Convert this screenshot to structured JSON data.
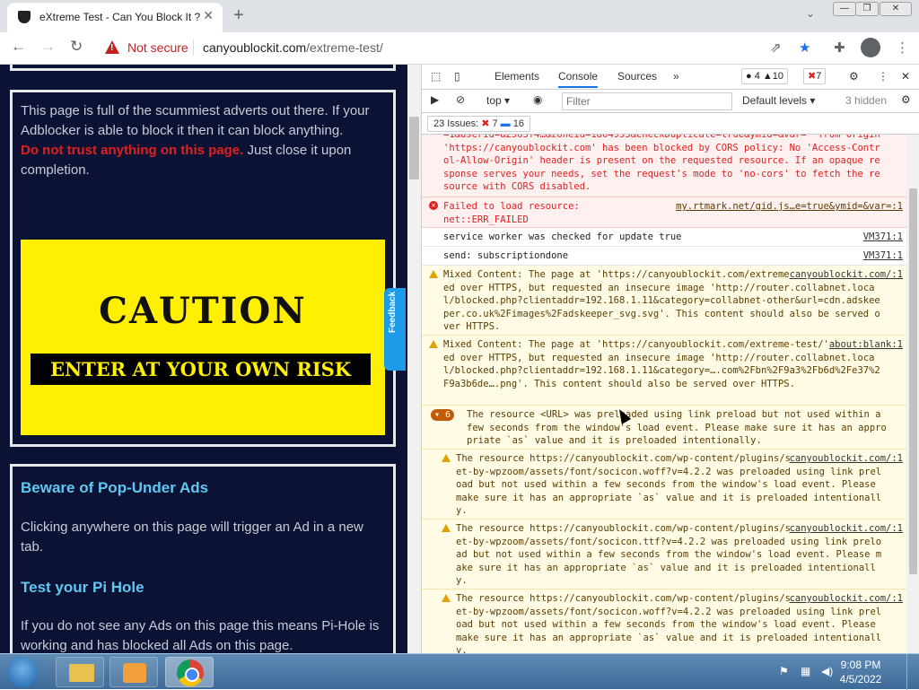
{
  "tab": {
    "title": "eXtreme Test - Can You Block It ?",
    "close": "✕"
  },
  "toolbar": {
    "not_secure": "Not secure",
    "url_host": "canyoublockit.com",
    "url_path": "/extreme-test/"
  },
  "page": {
    "intro": "This page is full of the scummiest adverts out there. If your Adblocker is able to block it then it can block anything.",
    "warning_red": "Do not trust anything on this page.",
    "warning_rest": " Just close it upon completion.",
    "caution_title": "CAUTION",
    "caution_sub": "ENTER AT YOUR OWN RISK",
    "feedback": "Feedback",
    "h1": "Beware of Pop-Under Ads",
    "p1": "Clicking anywhere on this page will trigger an Ad in a new tab.",
    "h2": "Test your Pi Hole",
    "p2": "If you do not see any Ads on this page this means Pi-Hole is working and has blocked all Ads on this page."
  },
  "devtools": {
    "tabs": [
      "Elements",
      "Console",
      "Sources"
    ],
    "counts": {
      "errors": "4",
      "warnings": "10",
      "issues_red": "7"
    },
    "context": "top",
    "filter_placeholder": "Filter",
    "levels": "Default levels",
    "hidden": "3 hidden",
    "issues_label": "23 Issues:",
    "issues_red": "7",
    "issues_blue": "16",
    "messages": [
      {
        "text": "=1&userid=a2563f4…&zoneid=1864953&checkDuplicate=true&ymid=&var=' from origin 'https://canyoublockit.com' has been blocked by CORS policy: No 'Access-Control-Allow-Origin' header is present on the requested resource. If an opaque response serves your needs, set the request's mode to 'no-cors' to fetch the resource with CORS disabled.",
        "src": ""
      },
      {
        "text": "Failed to load resource:\nnet::ERR_FAILED",
        "src": "my.rtmark.net/gid.js…e=true&ymid=&var=:1"
      },
      {
        "text": "service worker was checked for update true",
        "src": "VM371:1"
      },
      {
        "text": "send: subscriptiondone",
        "src": "VM371:1"
      },
      {
        "text": "Mixed Content: The page at 'https://canyoublockit.com/extreme-test/' was loaded over HTTPS, but requested an insecure image 'http://router.collabnet.local/blocked.php?clientaddr=192.168.1.11&category=collabnet-other&url=cdn.adskeeper.co.uk%2Fimages%2Fadskeeper_svg.svg'. This content should also be served over HTTPS.",
        "src": "canyoublockit.com/:1"
      },
      {
        "text": "Mixed Content: The page at 'https://canyoublockit.com/extreme-test/' was loaded over HTTPS, but requested an insecure image 'http://router.collabnet.local/blocked.php?clientaddr=192.168.1.11&category=….com%2Fbn%2F9a3%2Fb6d%2Fe37%2F9a3b6de….png'. This content should also be served over HTTPS.",
        "src": "about:blank:1"
      },
      {
        "badge": "6",
        "text": "The resource <URL> was preloaded using link preload but not used within a few seconds from the window's load event. Please make sure it has an appropriate `as` value and it is preloaded intentionally.",
        "src": ""
      },
      {
        "text": "The resource https://canyoublockit.com/wp-content/plugins/social-icons-widget-by-wpzoom/assets/font/socicon.woff?v=4.2.2 was preloaded using link preload but not used within a few seconds from the window's load event. Please make sure it has an appropriate `as` value and it is preloaded intentionally.",
        "src": "canyoublockit.com/:1"
      },
      {
        "text": "The resource https://canyoublockit.com/wp-content/plugins/social-icons-widget-by-wpzoom/assets/font/socicon.ttf?v=4.2.2 was preloaded using link preload but not used within a few seconds from the window's load event. Please make sure it has an appropriate `as` value and it is preloaded intentionally.",
        "src": "canyoublockit.com/:1"
      },
      {
        "text": "The resource https://canyoublockit.com/wp-content/plugins/social-icons-widget-by-wpzoom/assets/font/socicon.woff?v=4.2.2 was preloaded using link preload but not used within a few seconds from the window's load event. Please make sure it has an appropriate `as` value and it is preloaded intentionally.",
        "src": "canyoublockit.com/:1"
      }
    ]
  },
  "taskbar": {
    "time": "9:08 PM",
    "date": "4/5/2022"
  },
  "colors": {
    "page_bg": "#0b1233",
    "caution_yellow": "#ffef00",
    "heading_cyan": "#5fc8f2",
    "warning_red": "#e02020",
    "accent": "#1a73e8"
  },
  "icons": [
    "shield-tab-icon",
    "back-arrow-icon",
    "forward-arrow-icon",
    "reload-icon",
    "warning-icon",
    "share-icon",
    "star-icon",
    "extensions-icon",
    "profile-icon",
    "menu-icon",
    "inspect-icon",
    "device-icon",
    "gear-icon",
    "close-icon",
    "sidebar-icon",
    "clear-icon",
    "eye-icon",
    "start-icon",
    "explorer-icon",
    "media-icon",
    "chrome-icon"
  ]
}
